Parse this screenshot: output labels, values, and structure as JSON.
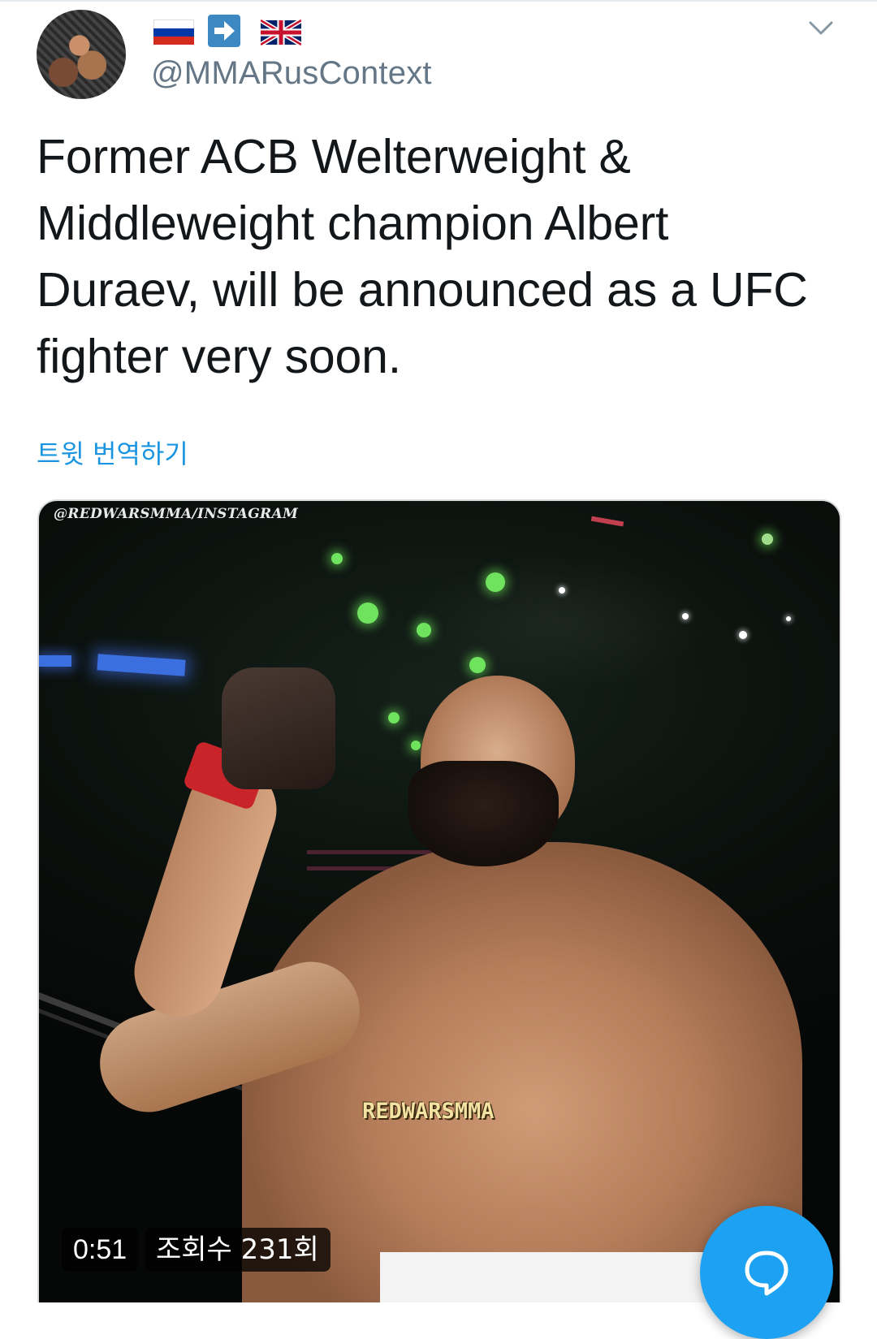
{
  "tweet": {
    "avatar_icon": "mma-fighter-avatar",
    "display_flags": [
      "russia-flag-icon",
      "right-arrow-icon",
      "uk-flag-icon"
    ],
    "handle": "@MMARusContext",
    "text": "Former ACB Welterweight &\nMiddleweight champion Albert\nDuraev, will be announced as a UFC\nfighter very soon.",
    "translate_label": "트윗 번역하기",
    "menu_icon": "chevron-down-icon"
  },
  "media": {
    "watermark_top": "@REDWARSMMA/INSTAGRAM",
    "watermark_center": "REDWARSMMA",
    "duration": "0:51",
    "views": "조회수 231회"
  },
  "fab": {
    "icon": "reply-bubble-icon",
    "color": "#1da1f2"
  },
  "colors": {
    "link": "#1b95e0",
    "handle": "#657786",
    "text": "#14171a"
  }
}
